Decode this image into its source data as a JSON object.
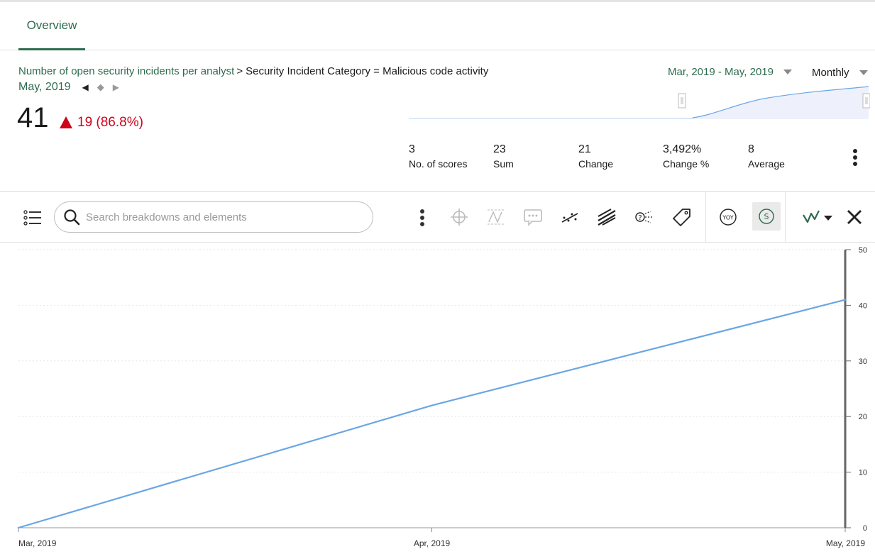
{
  "tabs": [
    {
      "label": "Overview"
    }
  ],
  "header": {
    "indicator": "Number of open security incidents per analyst",
    "separator": ">",
    "filter": "Security Incident Category = Malicious code activity",
    "period": "May, 2019",
    "score": "41",
    "change": "19 (86.8%)",
    "date_range": "Mar, 2019 - May, 2019",
    "frequency": "Monthly"
  },
  "stats": [
    {
      "value": "3",
      "label": "No. of scores"
    },
    {
      "value": "23",
      "label": "Sum"
    },
    {
      "value": "21",
      "label": "Change"
    },
    {
      "value": "3,492%",
      "label": "Change %"
    },
    {
      "value": "8",
      "label": "Average"
    }
  ],
  "toolbar": {
    "search_placeholder": "Search breakdowns and elements",
    "yoy_label": "YOY",
    "s_label": "S"
  },
  "colors": {
    "accent": "#2e6b4f",
    "negative": "#d0021b",
    "line": "#6aa6e4"
  },
  "chart_data": {
    "type": "line",
    "x": [
      "Mar, 2019",
      "Apr, 2019",
      "May, 2019"
    ],
    "series": [
      {
        "values": [
          0,
          22,
          41
        ]
      }
    ],
    "yticks": [
      0,
      10,
      20,
      30,
      40,
      50
    ],
    "ylim": [
      0,
      50
    ],
    "y_axis_side": "right",
    "grid": true
  }
}
